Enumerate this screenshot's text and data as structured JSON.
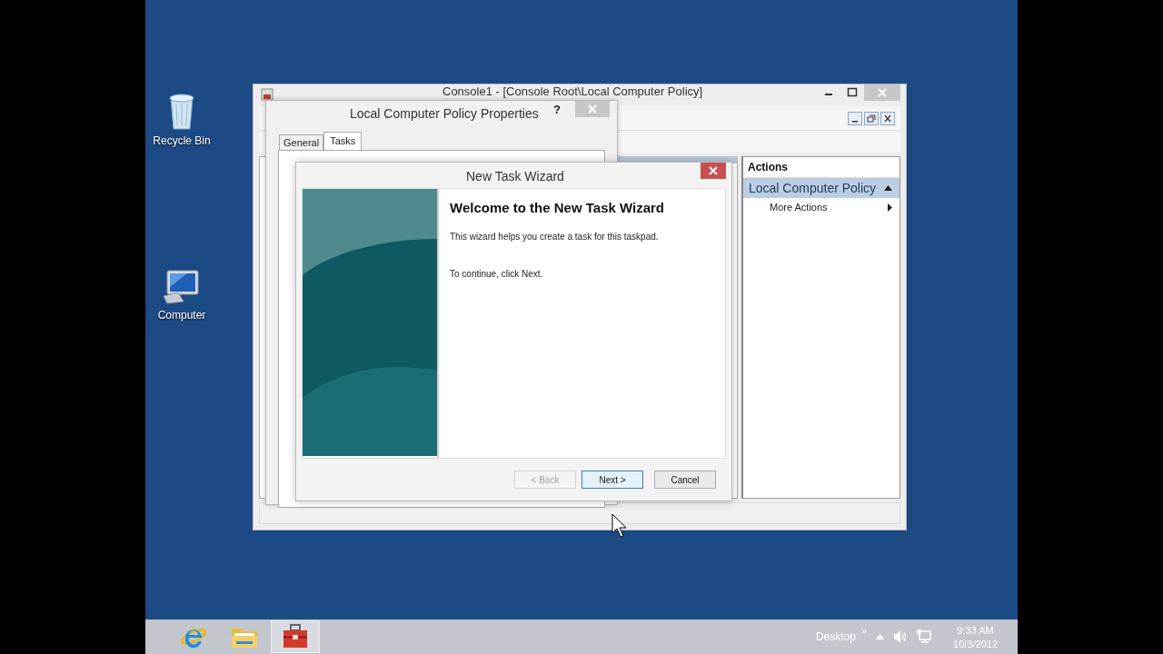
{
  "desktop_icons": [
    {
      "label": "Recycle Bin",
      "kind": "recycle"
    },
    {
      "label": "Computer",
      "kind": "computer"
    }
  ],
  "mmc": {
    "title": "Console1 - [Console Root\\Local Computer Policy]",
    "actions": {
      "header": "Actions",
      "section": "Local Computer Policy",
      "items": [
        "More Actions"
      ]
    }
  },
  "properties": {
    "title": "Local Computer Policy Properties",
    "help": "?",
    "tabs": [
      {
        "label": "General",
        "selected": false
      },
      {
        "label": "Tasks",
        "selected": true
      }
    ]
  },
  "wizard": {
    "title": "New Task Wizard",
    "heading": "Welcome to the New Task Wizard",
    "paragraphs": [
      "This wizard helps you create a task for this taskpad.",
      "To continue, click Next."
    ],
    "buttons": [
      {
        "label": "< Back",
        "disabled": true,
        "default": false
      },
      {
        "label": "Next >",
        "disabled": false,
        "default": true
      },
      {
        "label": "Cancel",
        "disabled": false,
        "default": false
      }
    ]
  },
  "taskbar": {
    "apps": [
      {
        "kind": "ie",
        "active": false
      },
      {
        "kind": "folder",
        "active": false
      },
      {
        "kind": "toolbox",
        "active": true
      }
    ],
    "toolbar_label": "Desktop",
    "overflow": "»",
    "time": "9:33 AM",
    "date": "10/3/2012"
  }
}
